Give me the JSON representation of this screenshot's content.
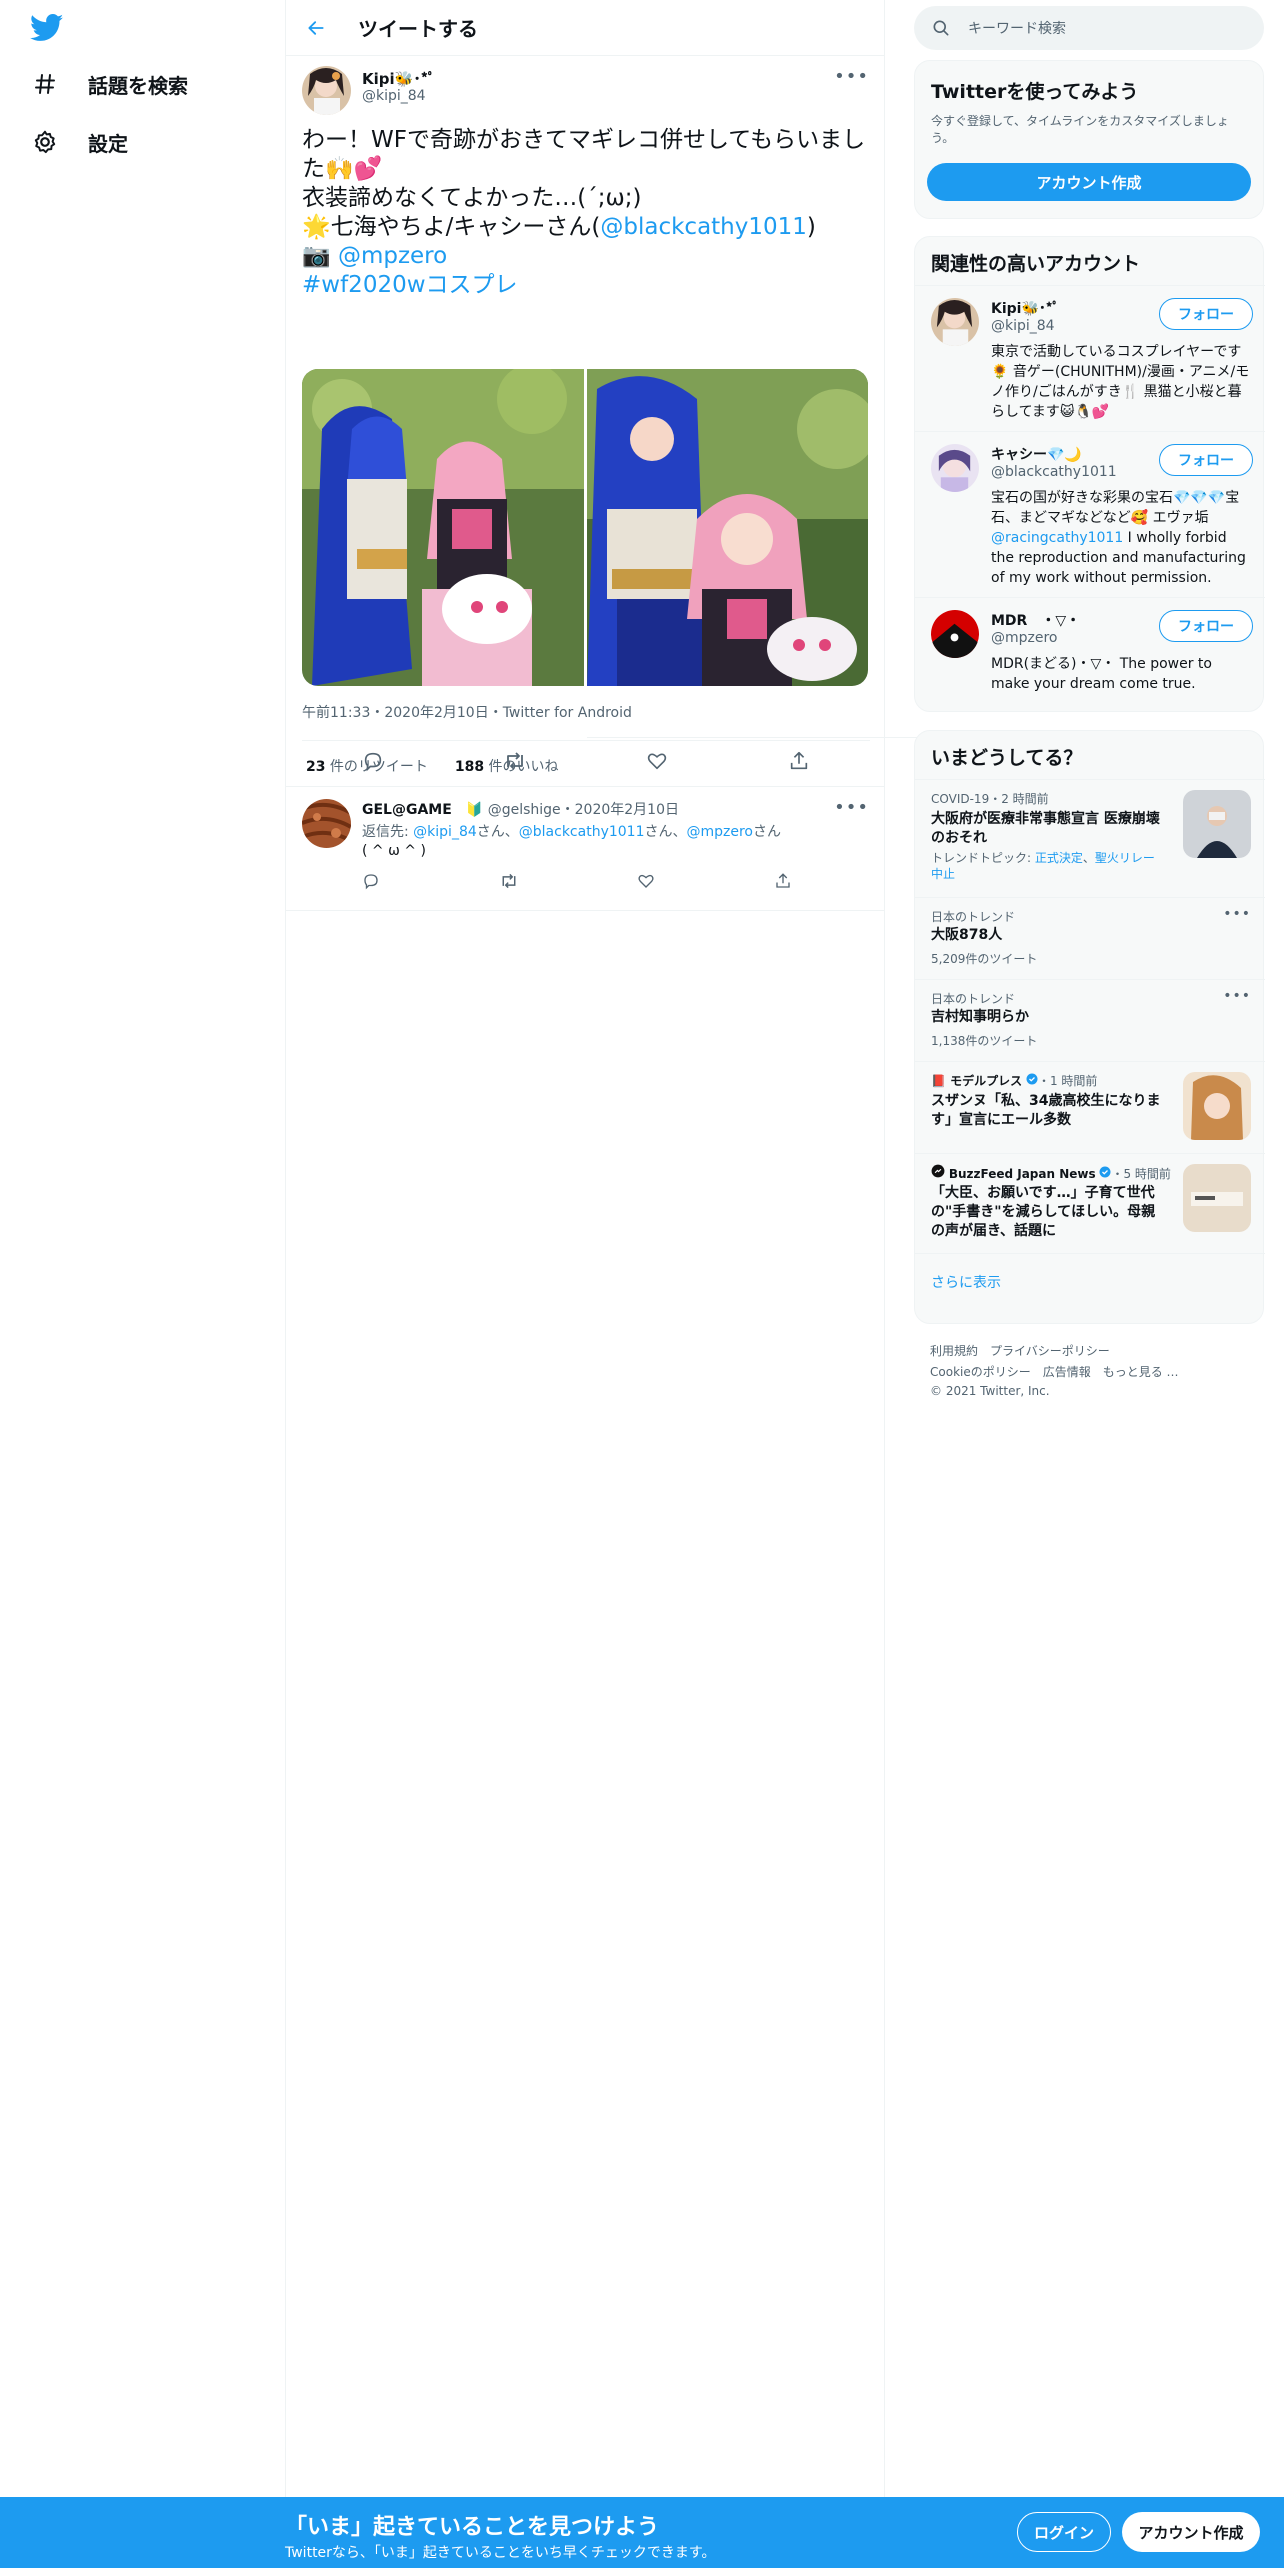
{
  "nav": {
    "logo": "twitter-bird-icon",
    "items": [
      {
        "label": "話題を検索",
        "icon": "hashtag-icon"
      },
      {
        "label": "設定",
        "icon": "gear-icon"
      }
    ]
  },
  "header": {
    "title": "ツイートする"
  },
  "tweet": {
    "author_name": "Kipi🐝･*ﾟ",
    "author_handle": "@kipi_84",
    "lines": [
      "わー！WFで奇跡がおきてマギレコ併せしてもらいました🙌💕",
      "衣装諦めなくてよかった…(´;ω;)",
      "🌟七海やちよ/キャシーさん(",
      "@blackcathy1011",
      ")",
      "📷 ",
      "@mpzero",
      "#wf2020wコスプレ"
    ],
    "meta": "午前11:33・2020年2月10日・Twitter for Android",
    "retweets_count": "23",
    "retweets_label": " 件のリツイート",
    "likes_count": "188",
    "likes_label": " 件のいいね"
  },
  "reply": {
    "name": "GEL@GAME　🔰",
    "handle_date": "@gelshige・2020年2月10日",
    "to_prefix": "返信先: ",
    "to_1": "@kipi_84",
    "san1": "さん、",
    "to_2": "@blackcathy1011",
    "san2": "さん、",
    "to_3": "@mpzero",
    "san3": "さん",
    "text": "( ^ ω ^ )"
  },
  "right": {
    "search_placeholder": "キーワード検索",
    "signup": {
      "title": "Twitterを使ってみよう",
      "desc": "今すぐ登録して、タイムラインをカスタマイズしましょう。",
      "button": "アカウント作成"
    },
    "related": {
      "title": "関連性の高いアカウント",
      "follow_label": "フォロー",
      "accounts": [
        {
          "name": "Kipi🐝･*ﾟ",
          "handle": "@kipi_84",
          "bio": "東京で活動しているコスプレイヤーです🌻 音ゲー(CHUNITHM)/漫画・アニメ/モノ作り/ごはんがすき🍴 黒猫と小桜と暮らしてます😺🐧💕"
        },
        {
          "name": "キャシー💎🌙",
          "handle": "@blackcathy1011",
          "bio_a": "宝石の国が好きな彩果の宝石💎💎💎宝石、まどマギなどなど🥰 エヴァ垢",
          "bio_link": "@racingcathy1011",
          "bio_b": " I wholly forbid the reproduction and manufacturing of my work without permission."
        },
        {
          "name": "MDR　・▽・",
          "handle": "@mpzero",
          "bio": "MDR(まどる)・▽・ The power to make your dream come true."
        }
      ]
    },
    "trends": {
      "title": "いまどうしてる？",
      "items": [
        {
          "context": "COVID-19・2 時間前",
          "title": "大阪府が医療非常事態宣言 医療崩壊のおそれ",
          "topic_prefix": "トレンドトピック: ",
          "topic_a": "正式決定",
          "topic_sep": "、",
          "topic_b": "聖火リレー中止"
        },
        {
          "context": "日本のトレンド",
          "title": "大阪878人",
          "count": "5,209件のツイート"
        },
        {
          "context": "日本のトレンド",
          "title": "吉村知事明らか",
          "count": "1,138件のツイート"
        },
        {
          "source": "📕 モデルプレス",
          "time": "・1 時間前",
          "title": "スザンヌ「私、34歳高校生になります」宣言にエール多数"
        },
        {
          "source": "BuzzFeed Japan News",
          "time": "・5 時間前",
          "title": "「大臣、お願いです…」子育て世代の\"手書き\"を減らしてほしい。母親の声が届き、話題に"
        }
      ],
      "show_more": "さらに表示"
    },
    "footer": {
      "line1": "利用規約　プライバシーポリシー",
      "line2": "Cookieのポリシー　広告情報　もっと見る …",
      "line3": "© 2021 Twitter, Inc."
    }
  },
  "bottom": {
    "title": "「いま」起きていることを見つけよう",
    "subtitle": "Twitterなら、「いま」起きていることをいち早くチェックできます。",
    "login": "ログイン",
    "signup": "アカウント作成"
  }
}
